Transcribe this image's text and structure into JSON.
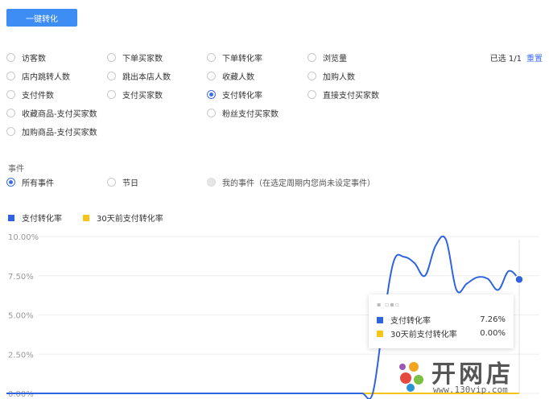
{
  "toolbar": {
    "one_click_label": "一键转化"
  },
  "metrics": [
    {
      "label": "访客数",
      "checked": false
    },
    {
      "label": "下单买家数",
      "checked": false
    },
    {
      "label": "下单转化率",
      "checked": false
    },
    {
      "label": "浏览量",
      "checked": false
    },
    {
      "label": "店内跳转人数",
      "checked": false
    },
    {
      "label": "跳出本店人数",
      "checked": false
    },
    {
      "label": "收藏人数",
      "checked": false
    },
    {
      "label": "加购人数",
      "checked": false
    },
    {
      "label": "支付件数",
      "checked": false
    },
    {
      "label": "支付买家数",
      "checked": false
    },
    {
      "label": "支付转化率",
      "checked": true
    },
    {
      "label": "直接支付买家数",
      "checked": false
    },
    {
      "label": "收藏商品-支付买家数",
      "checked": false
    },
    {
      "label": "粉丝支付买家数",
      "checked": false
    },
    {
      "label": "加购商品-支付买家数",
      "checked": false
    }
  ],
  "selection": {
    "count_label": "已选 1/1",
    "reset_label": "重置"
  },
  "events": {
    "title": "事件",
    "options": [
      {
        "label": "所有事件",
        "checked": true,
        "disabled": false
      },
      {
        "label": "节日",
        "checked": false,
        "disabled": false
      },
      {
        "label": "我的事件（在选定周期内您尚未设定事件）",
        "checked": false,
        "disabled": true
      }
    ]
  },
  "colors": {
    "accent": "#3d6ce6",
    "series_primary": "#2f63e0",
    "series_secondary": "#f5c518",
    "button": "#3d8df5"
  },
  "chart_data": {
    "type": "line",
    "y_tick_labels": [
      "10.00%",
      "7.50%",
      "5.00%",
      "2.50%",
      "0.00%"
    ],
    "ylim": [
      0,
      10
    ],
    "series": [
      {
        "name": "支付转化率",
        "color": "#2f63e0",
        "values": [
          0,
          0,
          0,
          0,
          0,
          0,
          0,
          0,
          0,
          0,
          0,
          0,
          0,
          0,
          0,
          0,
          0,
          0,
          0,
          0,
          0,
          0,
          0,
          0,
          0,
          0,
          0,
          0,
          0,
          0,
          0,
          0,
          0,
          0,
          0,
          0,
          4.5,
          8.4,
          8.7,
          8.3,
          7.5,
          9.4,
          9.8,
          6.6,
          7.0,
          7.4,
          7.3,
          6.6,
          7.8,
          7.26
        ]
      },
      {
        "name": "30天前支付转化率",
        "color": "#f5c518",
        "values": [
          0,
          0,
          0,
          0,
          0,
          0,
          0,
          0,
          0,
          0,
          0,
          0,
          0,
          0,
          0,
          0,
          0,
          0,
          0,
          0,
          0,
          0,
          0,
          0,
          0,
          0,
          0,
          0,
          0,
          0,
          0,
          0,
          0,
          0,
          0,
          0,
          0,
          0,
          0,
          0,
          0,
          0,
          0,
          0,
          0,
          0,
          0,
          0,
          0,
          0
        ]
      }
    ]
  },
  "tooltip": {
    "rows": [
      {
        "label": "支付转化率",
        "value": "7.26%",
        "color": "#2f63e0"
      },
      {
        "label": "30天前支付转化率",
        "value": "0.00%",
        "color": "#f5c518"
      }
    ]
  },
  "watermark": {
    "text": "开网店",
    "url": "www.130vip.com"
  }
}
